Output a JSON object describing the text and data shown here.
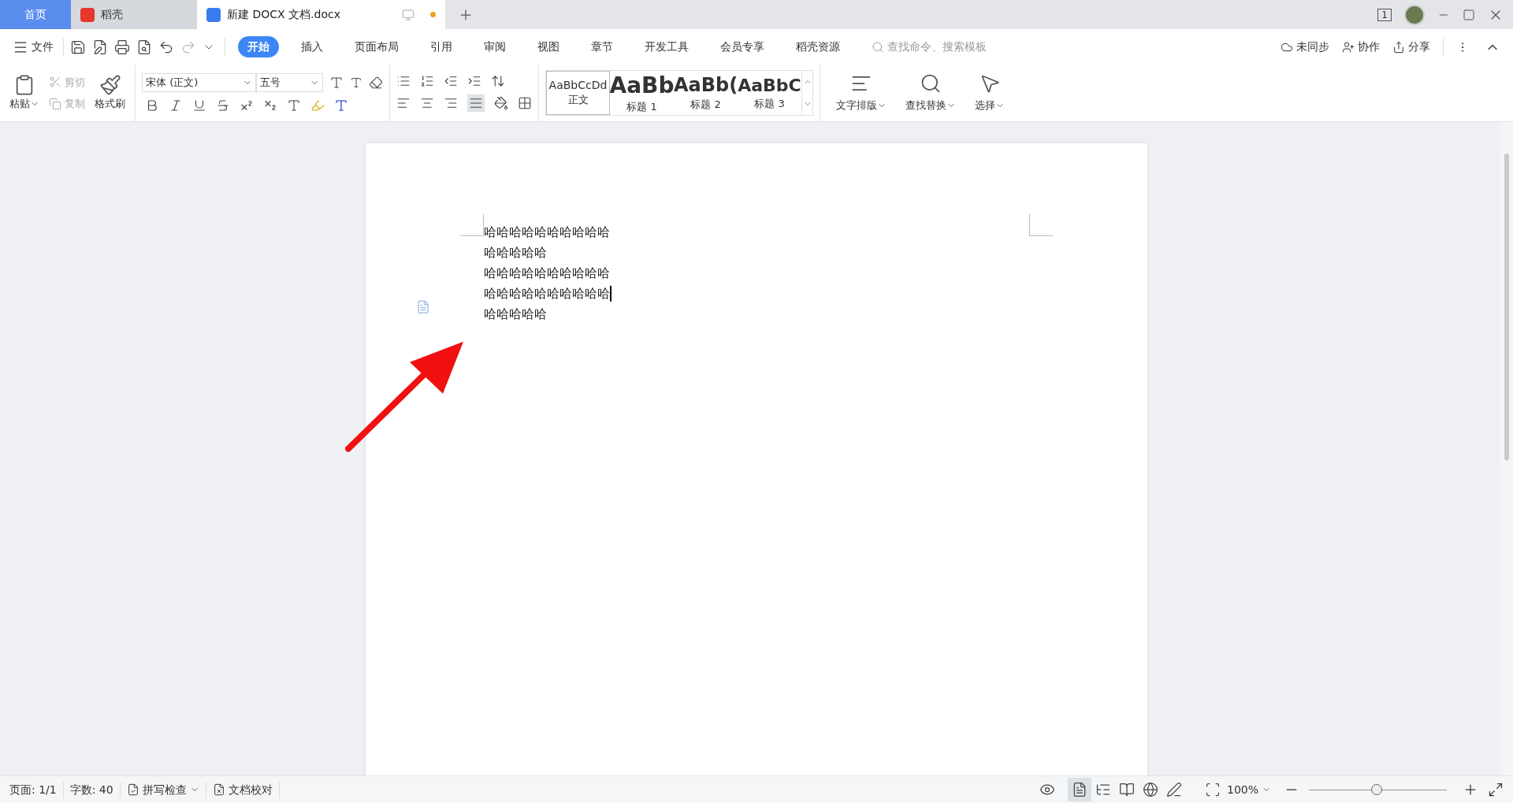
{
  "tabs": [
    {
      "kind": "home",
      "label": "首页",
      "selected": false
    },
    {
      "kind": "app",
      "label": "稻壳",
      "selected": false
    },
    {
      "kind": "doc",
      "label": "新建 DOCX 文档.docx",
      "selected": true,
      "unsaved": true
    }
  ],
  "window": {
    "badge": "1"
  },
  "menu": {
    "file": "文件",
    "ribbon_tabs": [
      {
        "label": "开始",
        "selected": true
      },
      {
        "label": "插入",
        "selected": false
      },
      {
        "label": "页面布局",
        "selected": false
      },
      {
        "label": "引用",
        "selected": false
      },
      {
        "label": "审阅",
        "selected": false
      },
      {
        "label": "视图",
        "selected": false
      },
      {
        "label": "章节",
        "selected": false
      },
      {
        "label": "开发工具",
        "selected": false
      },
      {
        "label": "会员专享",
        "selected": false
      },
      {
        "label": "稻壳资源",
        "selected": false
      }
    ],
    "search": {
      "placeholder": "查找命令、搜索模板"
    },
    "actions": [
      {
        "kind": "sync",
        "label": "未同步"
      },
      {
        "kind": "collab",
        "label": "协作"
      },
      {
        "kind": "share",
        "label": "分享"
      }
    ]
  },
  "ribbon": {
    "paste": "粘贴",
    "cut": {
      "label": "剪切",
      "disabled": true
    },
    "copy": {
      "label": "复制",
      "disabled": true
    },
    "painter": "格式刷",
    "font": "宋体 (正文)",
    "size": "五号",
    "justify_selected": true,
    "styles": [
      {
        "sample": "AaBbCcDd",
        "label": "正文",
        "selected": true,
        "kind": "normal"
      },
      {
        "sample": "AaBb",
        "label": "标题 1",
        "selected": false,
        "kind": "h1"
      },
      {
        "sample": "AaBb(",
        "label": "标题 2",
        "selected": false,
        "kind": "h2"
      },
      {
        "sample": "AaBbC",
        "label": "标题 3",
        "selected": false,
        "kind": "h3"
      }
    ],
    "tools": [
      {
        "kind": "layout",
        "label": "文字排版"
      },
      {
        "kind": "find",
        "label": "查找替换"
      },
      {
        "kind": "select",
        "label": "选择"
      }
    ]
  },
  "document": {
    "lines": [
      {
        "text": "哈哈哈哈哈哈哈哈哈哈",
        "cursor": false
      },
      {
        "text": "哈哈哈哈哈",
        "cursor": false
      },
      {
        "text": "哈哈哈哈哈哈哈哈哈哈",
        "cursor": false
      },
      {
        "text": "哈哈哈哈哈哈哈哈哈哈",
        "cursor": true
      },
      {
        "text": "哈哈哈哈哈",
        "cursor": false
      }
    ]
  },
  "status_bar": {
    "page": "页面: 1/1",
    "words": "字数: 40",
    "spell": "拼写检查",
    "proofread": "文档校对",
    "views": [
      {
        "kind": "page",
        "selected": true
      },
      {
        "kind": "outline",
        "selected": false
      },
      {
        "kind": "read",
        "selected": false
      },
      {
        "kind": "web",
        "selected": false
      },
      {
        "kind": "write",
        "selected": false
      }
    ],
    "zoom": "100%",
    "zoom_slider": {
      "level": 0.49
    }
  }
}
